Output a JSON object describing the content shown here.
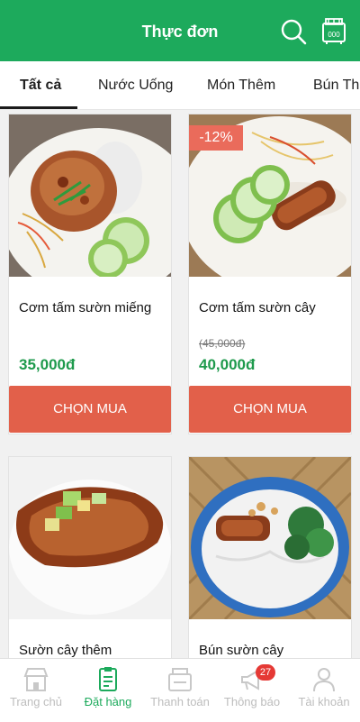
{
  "header": {
    "title": "Thực đơn",
    "search_icon": "search-icon",
    "cart_icon": "cart-icon",
    "cart_count": "000"
  },
  "tabs": [
    {
      "label": "Tất cả",
      "active": true
    },
    {
      "label": "Nước Uống",
      "active": false
    },
    {
      "label": "Món Thêm",
      "active": false
    },
    {
      "label": "Bún Thị",
      "active": false
    }
  ],
  "products": [
    {
      "name": "Cơm tấm sườn miếng",
      "price": "35,000đ",
      "old_price": "",
      "discount": "",
      "button": "CHỌN MUA"
    },
    {
      "name": "Cơm tấm sườn cây",
      "price": "40,000đ",
      "old_price": "(45,000đ)",
      "discount": "-12%",
      "button": "CHỌN MUA"
    },
    {
      "name": "Sườn cây thêm",
      "price": "",
      "old_price": "",
      "discount": "",
      "button": ""
    },
    {
      "name": "Bún sườn cây",
      "price": "",
      "old_price": "",
      "discount": "",
      "button": ""
    }
  ],
  "bottom_nav": [
    {
      "label": "Trang chủ",
      "icon": "store-icon",
      "active": false
    },
    {
      "label": "Đặt hàng",
      "icon": "order-icon",
      "active": true
    },
    {
      "label": "Thanh toán",
      "icon": "cashier-icon",
      "active": false
    },
    {
      "label": "Thông báo",
      "icon": "megaphone-icon",
      "active": false,
      "badge": "27"
    },
    {
      "label": "Tài khoản",
      "icon": "user-icon",
      "active": false
    }
  ],
  "colors": {
    "primary": "#1daa5c",
    "price": "#1e9a4c",
    "buy_button": "#e2604a",
    "discount_badge": "#ea6b5b",
    "nav_badge": "#e53935"
  }
}
